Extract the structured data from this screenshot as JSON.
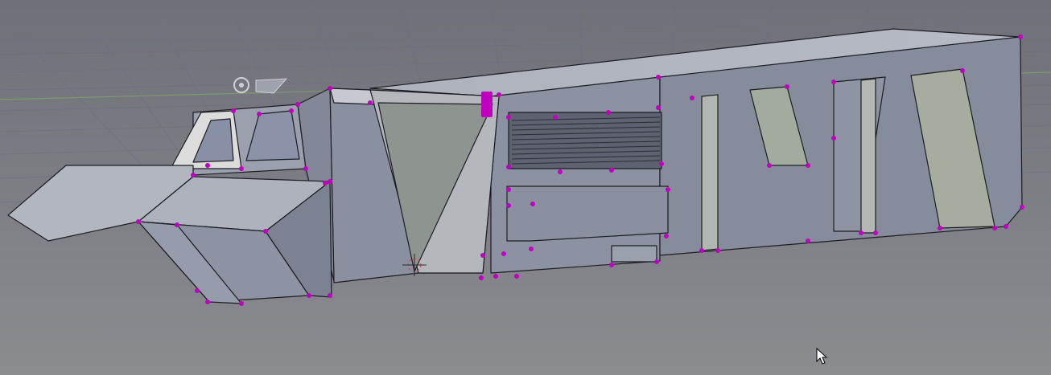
{
  "viewport": {
    "background_color": "#7b7c82",
    "grid_color": "#6e7188",
    "x_axis_color": "#7a8a6c",
    "vertex_color": "#c000c0",
    "edge_color": "#1c1c22",
    "active_object_color": "#dcdcdc"
  },
  "scene": {
    "object": "hovercraft-mesh",
    "mode": "edit-mode-vertex-select",
    "selection": "vertices-highlighted"
  },
  "icons": {
    "origin": "3d-cursor-icon",
    "lamp": "lamp-icon",
    "pointer": "mouse-pointer-icon"
  }
}
